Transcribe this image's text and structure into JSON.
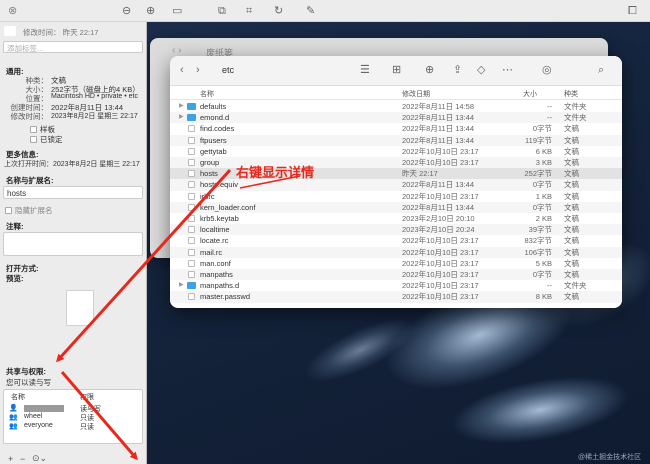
{
  "desktop": {
    "watermark": "@稀土掘金技术社区"
  },
  "back_window": {
    "title": "废纸篓"
  },
  "finder": {
    "path_title": "etc",
    "columns": {
      "name": "名称",
      "date": "修改日期",
      "size": "大小",
      "kind": "种类"
    },
    "rows": [
      {
        "name": "defaults",
        "date": "2022年8月11日 14:58",
        "size": "--",
        "kind": "文件夹",
        "icon": "folder",
        "disc": true
      },
      {
        "name": "emond.d",
        "date": "2022年8月11日 13:44",
        "size": "--",
        "kind": "文件夹",
        "icon": "folder",
        "disc": true
      },
      {
        "name": "find.codes",
        "date": "2022年8月11日 13:44",
        "size": "0字节",
        "kind": "文稿",
        "icon": "doc",
        "disc": false
      },
      {
        "name": "ftpusers",
        "date": "2022年8月11日 13:44",
        "size": "119字节",
        "kind": "文稿",
        "icon": "doc",
        "disc": false
      },
      {
        "name": "gettytab",
        "date": "2022年10月10日 23:17",
        "size": "6 KB",
        "kind": "文稿",
        "icon": "doc",
        "disc": false
      },
      {
        "name": "group",
        "date": "2022年10月10日 23:17",
        "size": "3 KB",
        "kind": "文稿",
        "icon": "doc",
        "disc": false
      },
      {
        "name": "hosts",
        "date": "昨天 22:17",
        "size": "252字节",
        "kind": "文稿",
        "icon": "doc",
        "disc": false
      },
      {
        "name": "hosts.equiv",
        "date": "2022年8月11日 13:44",
        "size": "0字节",
        "kind": "文稿",
        "icon": "doc",
        "disc": false
      },
      {
        "name": "irbrc",
        "date": "2022年10月10日 23:17",
        "size": "1 KB",
        "kind": "文稿",
        "icon": "doc",
        "disc": false
      },
      {
        "name": "kern_loader.conf",
        "date": "2022年8月11日 13:44",
        "size": "0字节",
        "kind": "文稿",
        "icon": "doc",
        "disc": false
      },
      {
        "name": "krb5.keytab",
        "date": "2023年2月10日 20:10",
        "size": "2 KB",
        "kind": "文稿",
        "icon": "doc",
        "disc": false
      },
      {
        "name": "localtime",
        "date": "2023年2月10日 20:24",
        "size": "39字节",
        "kind": "文稿",
        "icon": "doc",
        "disc": false
      },
      {
        "name": "locate.rc",
        "date": "2022年10月10日 23:17",
        "size": "832字节",
        "kind": "文稿",
        "icon": "doc",
        "disc": false
      },
      {
        "name": "mail.rc",
        "date": "2022年10月10日 23:17",
        "size": "106字节",
        "kind": "文稿",
        "icon": "doc",
        "disc": false
      },
      {
        "name": "man.conf",
        "date": "2022年10月10日 23:17",
        "size": "5 KB",
        "kind": "文稿",
        "icon": "doc",
        "disc": false
      },
      {
        "name": "manpaths",
        "date": "2022年10月10日 23:17",
        "size": "0字节",
        "kind": "文稿",
        "icon": "doc",
        "disc": false
      },
      {
        "name": "manpaths.d",
        "date": "2022年10月10日 23:17",
        "size": "--",
        "kind": "文件夹",
        "icon": "folder",
        "disc": true
      },
      {
        "name": "master.passwd",
        "date": "2022年10月10日 23:17",
        "size": "8 KB",
        "kind": "文稿",
        "icon": "doc",
        "disc": false
      }
    ]
  },
  "info": {
    "modified_top": "修改时间：  昨天 22:17",
    "tags_placeholder": "添加标签...",
    "general": "通用:",
    "kind_label": "种类：",
    "kind": "文稿",
    "size_label": "大小：",
    "size": "252字节（磁盘上的4 KB）",
    "where_label": "位置：",
    "where": "Macintosh HD • private • etc",
    "created_label": "创建时间：",
    "created": "2022年8月11日 13:44",
    "modified_label": "修改时间：",
    "modified": "2023年8月2日 星期三 22:17",
    "stationery": "样板",
    "locked": "已锁定",
    "more_info": "更多信息:",
    "last_opened": "上次打开时间：2023年8月2日 星期三 22:17",
    "name_ext": "名称与扩展名:",
    "filename": "hosts",
    "hide_ext": "隐藏扩展名",
    "comments": "注释:",
    "open_with": "打开方式:",
    "preview": "预览:",
    "sharing": "共享与权限:",
    "can_rw": "您可以读与写",
    "perm_name_col": "名称",
    "perm_priv_col": "权限",
    "perms": [
      {
        "name": "",
        "priv": "读与写"
      },
      {
        "name": "wheel",
        "priv": "只读"
      },
      {
        "name": "everyone",
        "priv": "只读"
      }
    ]
  },
  "annotation": {
    "text": "右键显示详情",
    "color": "#e8281c"
  }
}
